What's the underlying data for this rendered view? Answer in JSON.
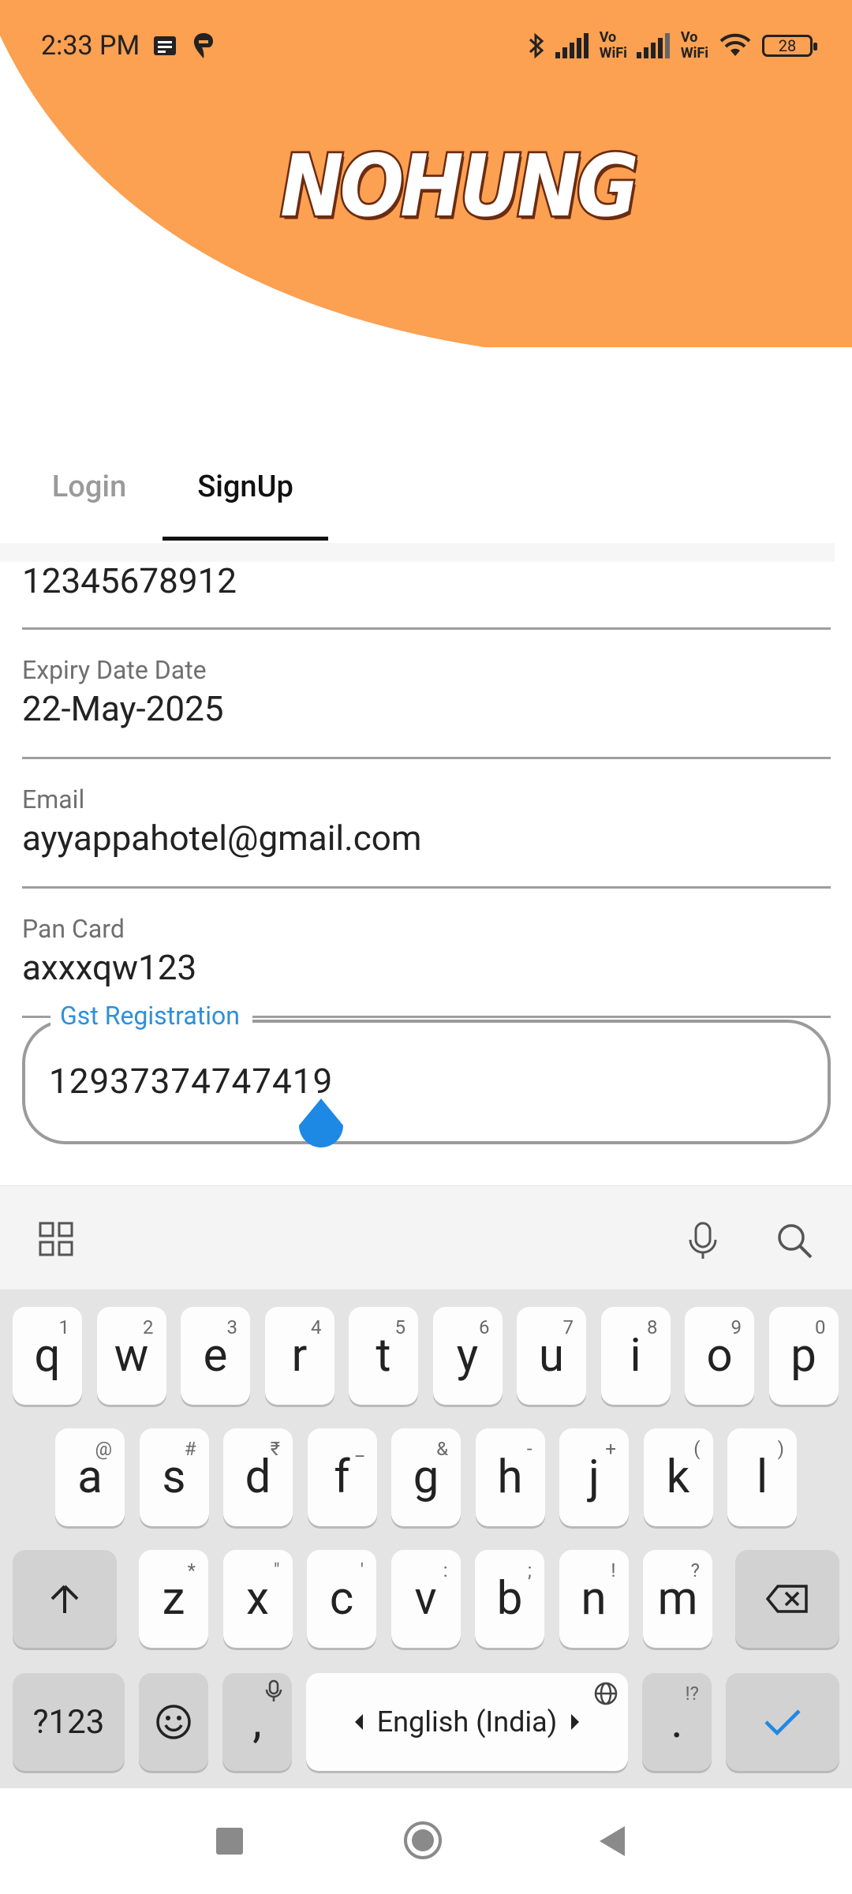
{
  "status_bar": {
    "time": "2:33 PM",
    "vowifi_1_top": "Vo",
    "vowifi_1_bottom": "WiFi",
    "vowifi_2_top": "Vo",
    "vowifi_2_bottom": "WiFi",
    "battery": "28"
  },
  "header": {
    "logo_text": "NOHUNG",
    "accent_color": "#FCA052"
  },
  "tabs": {
    "login": "Login",
    "signup": "SignUp",
    "active": "SignUp"
  },
  "form": {
    "partial_value": "12345678912",
    "expiry": {
      "label": "Expiry Date Date",
      "value": "22-May-2025"
    },
    "email": {
      "label": "Email",
      "value": "ayyappahotel@gmail.com"
    },
    "pan": {
      "label": "Pan Card",
      "value": "axxxqw123"
    },
    "gst": {
      "label": "Gst Registration",
      "value": "12937374747419"
    }
  },
  "keyboard": {
    "row1": [
      {
        "k": "q",
        "alt": "1"
      },
      {
        "k": "w",
        "alt": "2"
      },
      {
        "k": "e",
        "alt": "3"
      },
      {
        "k": "r",
        "alt": "4"
      },
      {
        "k": "t",
        "alt": "5"
      },
      {
        "k": "y",
        "alt": "6"
      },
      {
        "k": "u",
        "alt": "7"
      },
      {
        "k": "i",
        "alt": "8"
      },
      {
        "k": "o",
        "alt": "9"
      },
      {
        "k": "p",
        "alt": "0"
      }
    ],
    "row2": [
      {
        "k": "a",
        "alt": "@"
      },
      {
        "k": "s",
        "alt": "#"
      },
      {
        "k": "d",
        "alt": "₹"
      },
      {
        "k": "f",
        "alt": "_"
      },
      {
        "k": "g",
        "alt": "&"
      },
      {
        "k": "h",
        "alt": "-"
      },
      {
        "k": "j",
        "alt": "+"
      },
      {
        "k": "k",
        "alt": "("
      },
      {
        "k": "l",
        "alt": ")"
      }
    ],
    "row3": [
      {
        "k": "z",
        "alt": "*"
      },
      {
        "k": "x",
        "alt": "\""
      },
      {
        "k": "c",
        "alt": "'"
      },
      {
        "k": "v",
        "alt": ":"
      },
      {
        "k": "b",
        "alt": ";"
      },
      {
        "k": "n",
        "alt": "!"
      },
      {
        "k": "m",
        "alt": "?"
      }
    ],
    "numbers_key": "?123",
    "comma_key": ",",
    "space_label": "English (India)",
    "period_key": ".",
    "period_alt": "!?"
  }
}
